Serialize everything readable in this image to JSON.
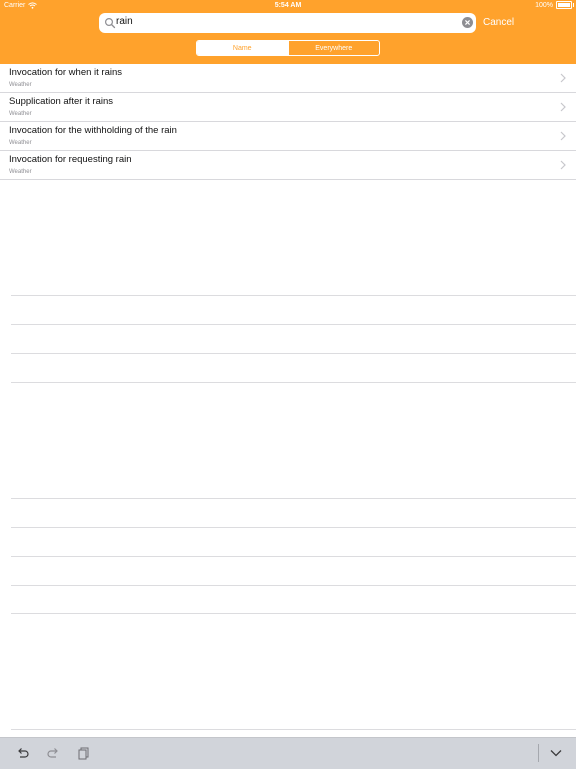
{
  "status_bar": {
    "carrier": "Carrier",
    "time": "5:54 AM",
    "battery": "100%"
  },
  "search": {
    "value": "rain",
    "cancel_label": "Cancel"
  },
  "scope": {
    "options": [
      "Name",
      "Everywhere"
    ],
    "selected": "Name"
  },
  "results": [
    {
      "title": "Invocation for when it rains",
      "subtitle": "Weather"
    },
    {
      "title": "Supplication after it rains",
      "subtitle": "Weather"
    },
    {
      "title": "Invocation for the withholding of the rain",
      "subtitle": "Weather"
    },
    {
      "title": "Invocation for requesting rain",
      "subtitle": "Weather"
    }
  ],
  "colors": {
    "accent": "#ffa22c",
    "toolbar": "#d1d4da"
  },
  "toolbar_icons": [
    "undo-icon",
    "redo-icon",
    "paste-icon",
    "chevron-down-icon"
  ]
}
